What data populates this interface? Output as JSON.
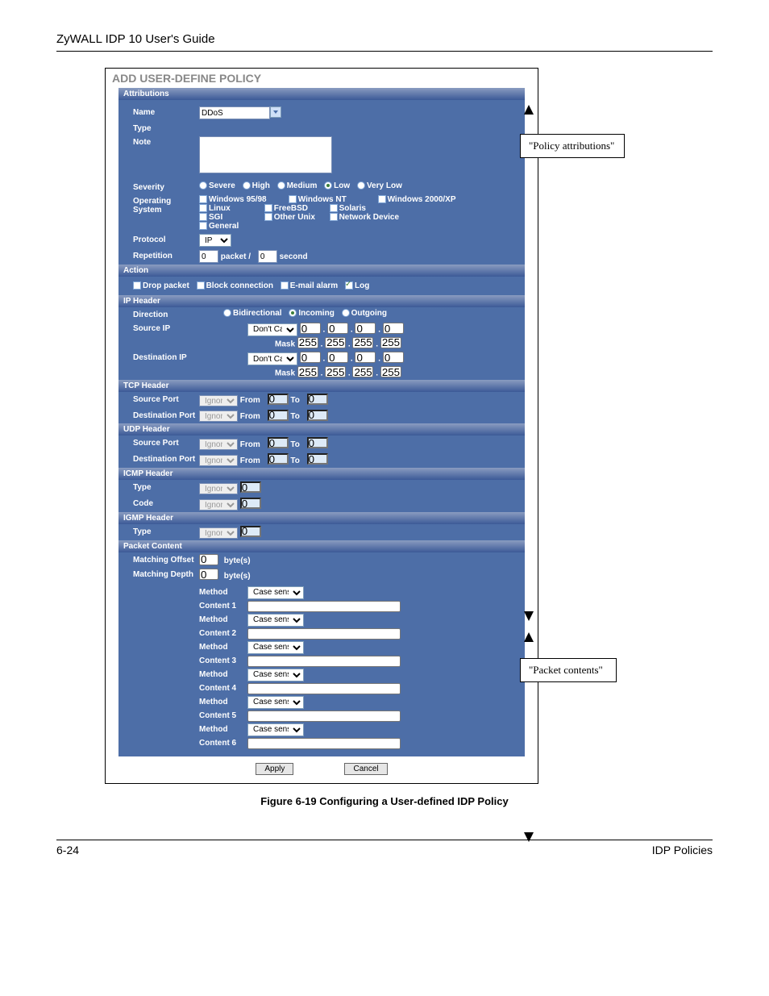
{
  "page": {
    "header": "ZyWALL IDP 10 User's Guide",
    "footer_left": "6-24",
    "footer_right": "IDP Policies",
    "figure_caption": "Figure 6-19 Configuring a User-defined IDP Policy"
  },
  "callouts": {
    "policy_attributions": "\"Policy attributions\"",
    "packet_contents": "\"Packet contents\""
  },
  "dialog": {
    "title": "ADD USER-DEFINE POLICY",
    "sections": {
      "attributions": "Attributions",
      "action": "Action",
      "ip_header": "IP Header",
      "tcp_header": "TCP Header",
      "udp_header": "UDP Header",
      "icmp_header": "ICMP Header",
      "igmp_header": "IGMP Header",
      "packet_content": "Packet Content"
    },
    "attributions": {
      "name_label": "Name",
      "name_value": "DDoS",
      "type_label": "Type",
      "note_label": "Note",
      "note_value": "",
      "severity_label": "Severity",
      "severity_options": [
        "Severe",
        "High",
        "Medium",
        "Low",
        "Very Low"
      ],
      "severity_selected": "Low",
      "os_label": "Operating System",
      "os_options": [
        "Windows 95/98",
        "Windows NT",
        "Windows 2000/XP",
        "Linux",
        "FreeBSD",
        "Solaris",
        "SGI",
        "Other Unix",
        "Network Device",
        "General"
      ],
      "protocol_label": "Protocol",
      "protocol_value": "IP",
      "repetition_label": "Repetition",
      "repetition_packet": "0",
      "repetition_packet_word": "packet /",
      "repetition_second_val": "0",
      "repetition_second_word": "second"
    },
    "action": {
      "drop_packet": "Drop packet",
      "block_connection": "Block connection",
      "email_alarm": "E-mail alarm",
      "log": "Log",
      "log_checked": true
    },
    "ip_header": {
      "direction_label": "Direction",
      "direction_options": [
        "Bidirectional",
        "Incoming",
        "Outgoing"
      ],
      "direction_selected": "Incoming",
      "source_ip_label": "Source IP",
      "dest_ip_label": "Destination IP",
      "dontcare": "Don't Care",
      "mask": "Mask",
      "ip_zero": "0",
      "mask_255": "255"
    },
    "ports": {
      "source_port": "Source Port",
      "dest_port": "Destination Port",
      "ignore": "Ignore",
      "from": "From",
      "to": "To",
      "val0": "0"
    },
    "icmp": {
      "type_label": "Type",
      "code_label": "Code",
      "ignore": "Ignore",
      "val0": "0"
    },
    "igmp": {
      "type_label": "Type",
      "ignore": "Ignore",
      "val0": "0"
    },
    "packet_content": {
      "matching_offset_label": "Matching Offset",
      "matching_depth_label": "Matching Depth",
      "offset_val": "0",
      "depth_val": "0",
      "bytes": "byte(s)",
      "method_label": "Method",
      "content_labels": [
        "Content 1",
        "Content 2",
        "Content 3",
        "Content 4",
        "Content 5",
        "Content 6"
      ],
      "case_sensitive": "Case sensitive"
    },
    "buttons": {
      "apply": "Apply",
      "cancel": "Cancel"
    }
  }
}
